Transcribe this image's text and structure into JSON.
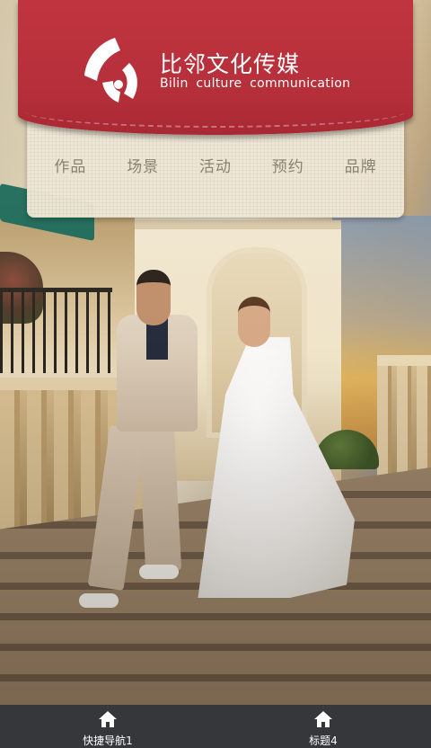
{
  "brand": {
    "name": "比邻文化传媒",
    "subtitle": "Bilin culture communication",
    "accent_color": "#b52f3a"
  },
  "nav": {
    "items": [
      {
        "label": "作品"
      },
      {
        "label": "场景"
      },
      {
        "label": "活动"
      },
      {
        "label": "预约"
      },
      {
        "label": "品牌"
      }
    ]
  },
  "hero": {
    "icon": "wedding-photo"
  },
  "bottom_nav": {
    "items": [
      {
        "label": "快捷导航1",
        "icon": "home-icon"
      },
      {
        "label": "标题4",
        "icon": "home-icon"
      }
    ]
  }
}
